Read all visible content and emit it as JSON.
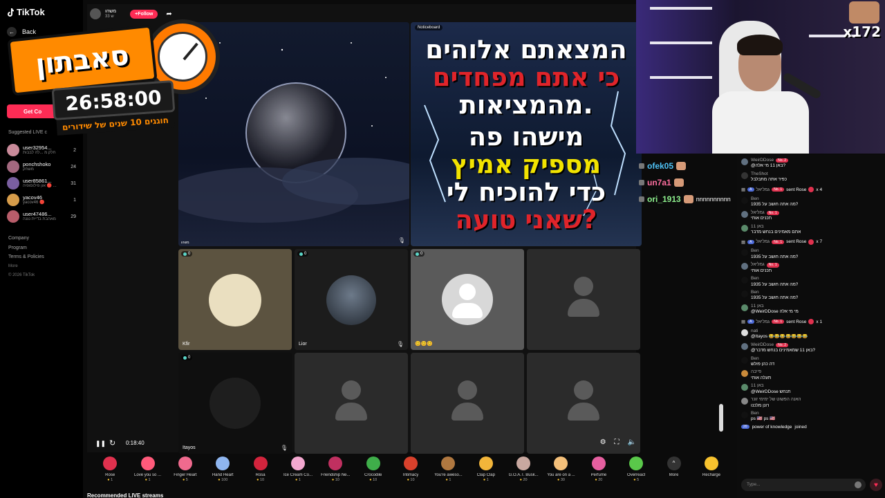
{
  "sidebar": {
    "brand": "TikTok",
    "back": "Back",
    "get_coins": "Get Co",
    "suggested_title": "Suggested LIVE c",
    "users": [
      {
        "name": "user32954...",
        "sub": "חלק מ ...לה לבבות",
        "count": "2",
        "color": "#c98a9a"
      },
      {
        "name": "ponchshoko",
        "sub": "משחק",
        "count": "24",
        "color": "#a3687f"
      },
      {
        "name": "user85861...",
        "sub": "און פילוסופיה 🔴 ...",
        "count": "31",
        "color": "#7a5fa0"
      },
      {
        "name": "yacov46",
        "sub": "yacov46 🔴",
        "count": "1",
        "color": "#d69c4a"
      },
      {
        "name": "user47486...",
        "sub": "מאהבת בדיית נגנה",
        "count": "29",
        "color": "#b85d6a"
      }
    ],
    "footer": [
      "Company",
      "Program",
      "Terms & Policies",
      "More"
    ],
    "copyright": "© 2026 TikTok"
  },
  "overlay": {
    "title": "סאבתון",
    "timer": "26:58:00",
    "subtitle": "חוגגים 10 שנים של שידורים"
  },
  "stream": {
    "host_name": "משהו",
    "host_sub": "33 ש",
    "follow": "+Follow",
    "notice_label": "Noticeboard",
    "notice_lines": [
      "המצאתם אלוהים",
      "כי אתם מפחדים",
      "מהמציאות.",
      "מישהו פה",
      "מספיק אמיץ",
      "כדי להוכיח לי",
      "שאני טועה?"
    ],
    "host_tile_label": "משהו",
    "tiles": [
      {
        "label": "Kfir",
        "badge": "0"
      },
      {
        "label": "Lior",
        "badge": "0"
      },
      {
        "label": "",
        "badge": "0"
      },
      {
        "label": "",
        "badge": ""
      },
      {
        "label": "Itayos",
        "badge": "0"
      },
      {
        "label": "",
        "badge": ""
      },
      {
        "label": "",
        "badge": ""
      },
      {
        "label": "",
        "badge": ""
      }
    ],
    "time": "0:18:40"
  },
  "gifts": [
    {
      "name": "Rose",
      "price": "1",
      "color": "#e0314e"
    },
    {
      "name": "Love you so ...",
      "price": "1",
      "color": "#ff5a7a"
    },
    {
      "name": "Finger Heart",
      "price": "5",
      "color": "#f06a8e"
    },
    {
      "name": "Hand Heart",
      "price": "100",
      "color": "#8fb6f0"
    },
    {
      "name": "Rosa",
      "price": "10",
      "color": "#d3243d"
    },
    {
      "name": "Ice Cream Co...",
      "price": "1",
      "color": "#f3a8d0"
    },
    {
      "name": "Friendship Ne...",
      "price": "10",
      "color": "#c03060"
    },
    {
      "name": "Crocodile",
      "price": "10",
      "color": "#3fae4a"
    },
    {
      "name": "Intimacy",
      "price": "10",
      "color": "#d9412c"
    },
    {
      "name": "You're aweso...",
      "price": "1",
      "color": "#b07840"
    },
    {
      "name": "Clap Clap",
      "price": "1",
      "color": "#f2b53a"
    },
    {
      "name": "G.O.A.T. Busk...",
      "price": "20",
      "color": "#c9a8a0"
    },
    {
      "name": "You are on a ...",
      "price": "30",
      "color": "#f4c07a"
    },
    {
      "name": "Perfume",
      "price": "20",
      "color": "#e65fa0"
    },
    {
      "name": "Overreact",
      "price": "5",
      "color": "#5ac84a"
    }
  ],
  "gift_more": "More",
  "recharge": "Recharge",
  "recommended": "Recommended LIVE streams",
  "cam": {
    "multiplier": "x172"
  },
  "overlay_chat": [
    {
      "name": "ofek05",
      "color": "#4fc3f7",
      "extra": ""
    },
    {
      "name": "un7a1",
      "color": "#ff6fa0",
      "extra": ""
    },
    {
      "name": "ori_1913",
      "color": "#8ef08e",
      "extra": "nnnnnnnnnn"
    }
  ],
  "chat": {
    "placeholder": "Type...",
    "messages": [
      {
        "kind": "msg",
        "user": "WeirDDose",
        "badge": "No. 2",
        "text": "@באן 11 מי אלה?",
        "color": "#607080"
      },
      {
        "kind": "msg",
        "user": "TheShot",
        "badge": "",
        "text": "כפיר אתה מתבלבל",
        "color": "#333"
      },
      {
        "kind": "gift",
        "user": "גמליאל",
        "text": "sent Rose",
        "count": "x 4"
      },
      {
        "kind": "msg",
        "user": "Ben",
        "badge": "",
        "text": "מה אתה חושב על 1935?",
        "color": "#111"
      },
      {
        "kind": "msg",
        "user": "גמליאל",
        "badge": "No. 1",
        "text": "תכנים אותי",
        "color": "#607080"
      },
      {
        "kind": "msg",
        "user": "באן 11",
        "badge": "",
        "text": "אתם מאמינים בנחש מדבר",
        "color": "#5a8a6a"
      },
      {
        "kind": "gift",
        "user": "גמליאל",
        "text": "sent Rose",
        "count": "x 7"
      },
      {
        "kind": "msg",
        "user": "Ben",
        "badge": "",
        "text": "מה אתה חושב על 1935?",
        "color": "#111"
      },
      {
        "kind": "msg",
        "user": "גמליאל",
        "badge": "No. 1",
        "text": "תכנים אותי",
        "color": "#607080"
      },
      {
        "kind": "msg",
        "user": "Ben",
        "badge": "",
        "text": "מה אתה חושב על 1935?",
        "color": "#111"
      },
      {
        "kind": "msg",
        "user": "Ben",
        "badge": "",
        "text": "מה אתה חושב על 1935?",
        "color": "#111"
      },
      {
        "kind": "msg",
        "user": "באן 11",
        "badge": "",
        "text": "@WeirDDose מי מי אלה",
        "color": "#5a8a6a"
      },
      {
        "kind": "gift",
        "user": "גמליאל",
        "text": "sent Rose",
        "count": "x 1"
      },
      {
        "kind": "msg",
        "user": "nati",
        "badge": "",
        "text": "@Itayos 😂😂😂😂😂😂😂",
        "color": "#ddd"
      },
      {
        "kind": "msg",
        "user": "WeirDDose",
        "badge": "No. 2",
        "text": "@באן 11 שמאמינים בנחש מדבר?",
        "color": "#607080"
      },
      {
        "kind": "msg",
        "user": "Ben",
        "badge": "",
        "text": "דה כהן פולש",
        "color": "#111"
      },
      {
        "kind": "msg",
        "user": "פייבה",
        "badge": "",
        "text": "תעלה אותי",
        "color": "#c98a3a"
      },
      {
        "kind": "msg",
        "user": "באן 11",
        "badge": "",
        "text": "@WeirDDose תנחש",
        "color": "#5a8a6a"
      },
      {
        "kind": "msg",
        "user": "האנה הפשוט של ימימי זונר",
        "badge": "",
        "text": "רונן מלכנו",
        "color": "#888"
      },
      {
        "kind": "msg",
        "user": "Ben",
        "badge": "",
        "text": "ps 🇺🇸 ps 🇺🇸",
        "color": "#111"
      }
    ],
    "joined_user": "power of knowledge",
    "joined_text": "joined",
    "joined_level": "20"
  }
}
